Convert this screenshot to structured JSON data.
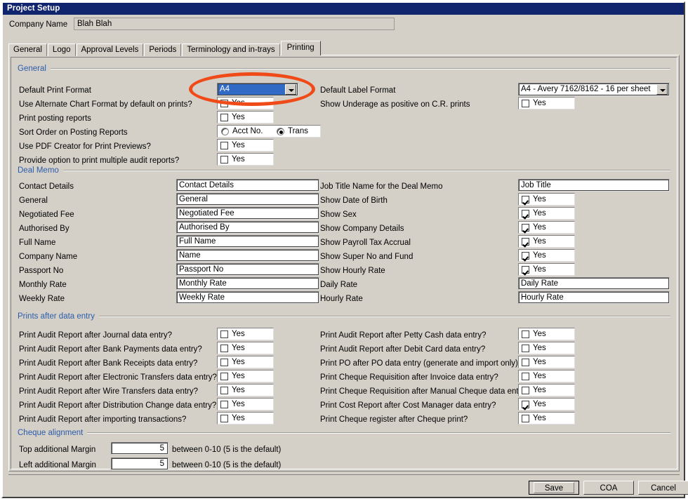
{
  "window": {
    "title": "Project Setup"
  },
  "company": {
    "label": "Company Name",
    "value": "Blah Blah"
  },
  "tabs": [
    {
      "label": "General",
      "active": false
    },
    {
      "label": "Logo",
      "active": false
    },
    {
      "label": "Approval Levels",
      "active": false
    },
    {
      "label": "Periods",
      "active": false
    },
    {
      "label": "Terminology and in-trays",
      "active": false
    },
    {
      "label": "Printing",
      "active": true
    }
  ],
  "groups": {
    "general": "General",
    "deal_memo": "Deal Memo",
    "prints_after_data_entry": "Prints after data entry",
    "cheque_alignment": "Cheque alignment"
  },
  "general": {
    "default_print_format": {
      "label": "Default Print Format",
      "value": "A4"
    },
    "use_alternate_chart_format": {
      "label": "Use Alternate Chart Format by default on prints?",
      "checked": false,
      "yes": "Yes"
    },
    "print_posting_reports": {
      "label": "Print posting reports",
      "checked": false,
      "yes": "Yes"
    },
    "sort_order": {
      "label": "Sort Order on Posting Reports",
      "options": [
        "Acct No.",
        "Trans"
      ],
      "selected": "Trans"
    },
    "use_pdf_creator": {
      "label": "Use PDF Creator for Print Previews?",
      "checked": false,
      "yes": "Yes"
    },
    "multiple_audit_reports": {
      "label": "Provide option to print multiple audit reports?",
      "checked": false,
      "yes": "Yes"
    },
    "default_label_format": {
      "label": "Default Label Format",
      "value": "A4 - Avery 7162/8162 - 16 per sheet"
    },
    "show_underage": {
      "label": "Show Underage as positive on C.R. prints",
      "checked": false,
      "yes": "Yes"
    }
  },
  "deal_memo": {
    "left": [
      {
        "label": "Contact Details",
        "value": "Contact Details"
      },
      {
        "label": "General",
        "value": "General"
      },
      {
        "label": "Negotiated Fee",
        "value": "Negotiated Fee"
      },
      {
        "label": "Authorised By",
        "value": "Authorised By"
      },
      {
        "label": "Full Name",
        "value": "Full Name"
      },
      {
        "label": "Company Name",
        "value": "Name"
      },
      {
        "label": "Passport No",
        "value": "Passport No"
      },
      {
        "label": "Monthly Rate",
        "value": "Monthly Rate"
      },
      {
        "label": "Weekly Rate",
        "value": "Weekly Rate"
      }
    ],
    "right": [
      {
        "label": "Job Title Name for the Deal Memo",
        "type": "text",
        "value": "Job Title"
      },
      {
        "label": "Show Date of Birth",
        "type": "check",
        "checked": true,
        "yes": "Yes"
      },
      {
        "label": "Show Sex",
        "type": "check",
        "checked": true,
        "yes": "Yes"
      },
      {
        "label": "Show Company Details",
        "type": "check",
        "checked": true,
        "yes": "Yes"
      },
      {
        "label": "Show Payroll Tax Accrual",
        "type": "check",
        "checked": true,
        "yes": "Yes"
      },
      {
        "label": "Show Super No and Fund",
        "type": "check",
        "checked": true,
        "yes": "Yes"
      },
      {
        "label": "Show Hourly Rate",
        "type": "check",
        "checked": true,
        "yes": "Yes"
      },
      {
        "label": "Daily Rate",
        "type": "text",
        "value": "Daily Rate"
      },
      {
        "label": "Hourly Rate",
        "type": "text",
        "value": "Hourly Rate"
      }
    ]
  },
  "prints_after_data_entry": {
    "left": [
      {
        "label": "Print Audit Report after Journal data entry?",
        "checked": false,
        "yes": "Yes"
      },
      {
        "label": "Print Audit Report after Bank Payments data entry?",
        "checked": false,
        "yes": "Yes"
      },
      {
        "label": "Print Audit Report after Bank Receipts data entry?",
        "checked": false,
        "yes": "Yes"
      },
      {
        "label": "Print Audit Report after Electronic Transfers data entry?",
        "checked": false,
        "yes": "Yes"
      },
      {
        "label": "Print Audit Report after Wire Transfers data entry?",
        "checked": false,
        "yes": "Yes"
      },
      {
        "label": "Print Audit Report after Distribution Change data entry?",
        "checked": false,
        "yes": "Yes"
      },
      {
        "label": "Print Audit Report after importing transactions?",
        "checked": false,
        "yes": "Yes"
      }
    ],
    "right": [
      {
        "label": "Print Audit Report after Petty Cash data entry?",
        "checked": false,
        "yes": "Yes"
      },
      {
        "label": "Print Audit Report after Debit Card data entry?",
        "checked": false,
        "yes": "Yes"
      },
      {
        "label": "Print PO after PO data entry (generate and import only)?",
        "checked": false,
        "yes": "Yes"
      },
      {
        "label": "Print Cheque Requisition after Invoice data entry?",
        "checked": false,
        "yes": "Yes"
      },
      {
        "label": "Print Cheque Requisition after Manual Cheque data entry?",
        "checked": false,
        "yes": "Yes"
      },
      {
        "label": "Print Cost Report after Cost Manager data entry?",
        "checked": true,
        "yes": "Yes"
      },
      {
        "label": "Print Cheque register after Cheque print?",
        "checked": false,
        "yes": "Yes"
      }
    ]
  },
  "cheque_alignment": {
    "rows": [
      {
        "label": "Top additional Margin",
        "value": "5",
        "hint": "between 0-10 (5 is the default)"
      },
      {
        "label": "Left additional Margin",
        "value": "5",
        "hint": "between 0-10 (5 is the default)"
      }
    ]
  },
  "buttons": {
    "save": "Save",
    "coa": "COA",
    "cancel": "Cancel"
  },
  "annotation": {
    "color": "#ef4a17",
    "target": "Default Print Format"
  }
}
